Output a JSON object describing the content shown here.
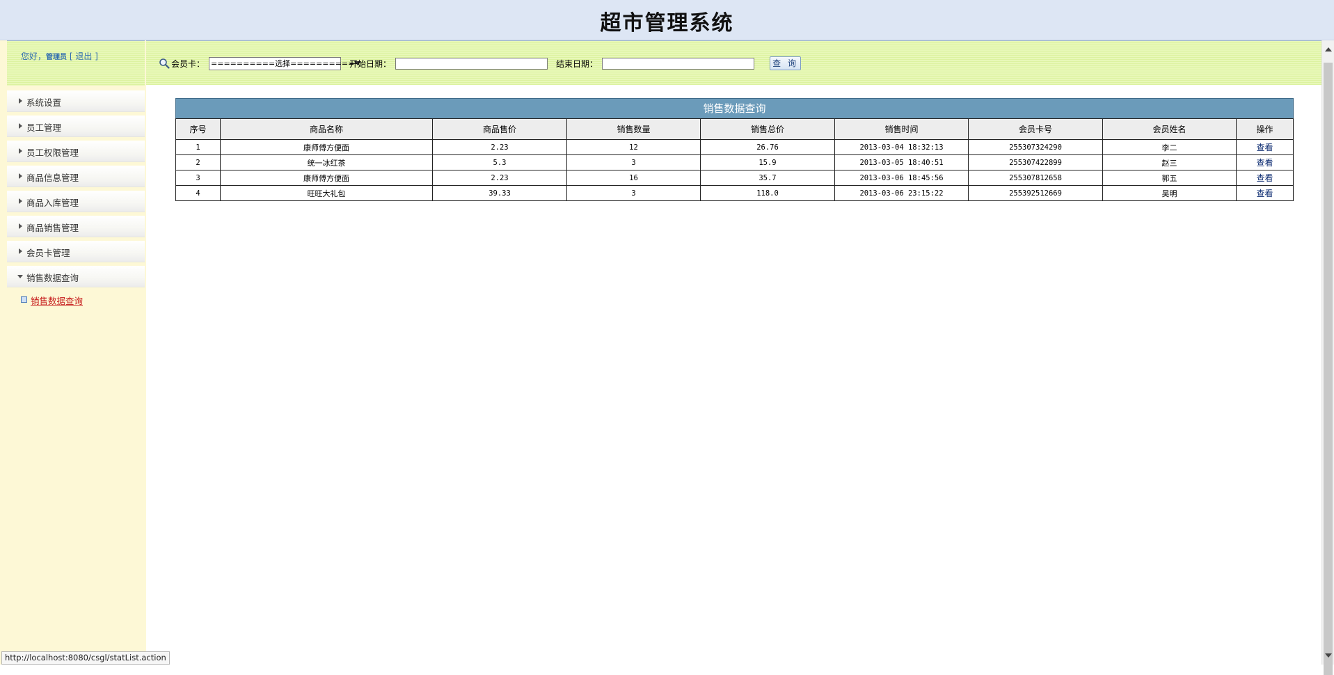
{
  "app": {
    "title": "超市管理系统"
  },
  "user": {
    "greeting": "您好，",
    "name": "管理员",
    "logout_open": "[",
    "logout": "退出",
    "logout_close": "]"
  },
  "menu": [
    {
      "label": "系统设置",
      "open": false
    },
    {
      "label": "员工管理",
      "open": false
    },
    {
      "label": "员工权限管理",
      "open": false
    },
    {
      "label": "商品信息管理",
      "open": false
    },
    {
      "label": "商品入库管理",
      "open": false
    },
    {
      "label": "商品销售管理",
      "open": false
    },
    {
      "label": "会员卡管理",
      "open": false
    },
    {
      "label": "销售数据查询",
      "open": true
    }
  ],
  "submenu": {
    "active": "销售数据查询"
  },
  "search": {
    "card_label": "会员卡：",
    "card_selected": "==========选择==========",
    "start_label": "开始日期：",
    "start_value": "",
    "end_label": "结束日期：",
    "end_value": "",
    "button": "查 询"
  },
  "table": {
    "caption": "销售数据查询",
    "headers": [
      "序号",
      "商品名称",
      "商品售价",
      "销售数量",
      "销售总价",
      "销售时间",
      "会员卡号",
      "会员姓名",
      "操作"
    ],
    "rows": [
      [
        "1",
        "康师傅方便面",
        "2.23",
        "12",
        "26.76",
        "2013-03-04 18:32:13",
        "255307324290",
        "李二",
        "查看"
      ],
      [
        "2",
        "统一冰红茶",
        "5.3",
        "3",
        "15.9",
        "2013-03-05 18:40:51",
        "255307422899",
        "赵三",
        "查看"
      ],
      [
        "3",
        "康师傅方便面",
        "2.23",
        "16",
        "35.7",
        "2013-03-06 18:45:56",
        "255307812658",
        "郭五",
        "查看"
      ],
      [
        "4",
        "旺旺大礼包",
        "39.33",
        "3",
        "118.0",
        "2013-03-06 23:15:22",
        "255392512669",
        "吴明",
        "查看"
      ]
    ]
  },
  "status": {
    "url": "http://localhost:8080/csgl/statList.action"
  },
  "colors": {
    "header_bg": "#dde6f4",
    "caption_bg": "#6b9bba",
    "active_link": "#c61b1b",
    "sidebar_bg": "#fdf8d6"
  },
  "icons": {
    "search": "magnifier-icon",
    "menu_closed": "triangle-right-icon",
    "menu_open": "triangle-down-icon"
  }
}
